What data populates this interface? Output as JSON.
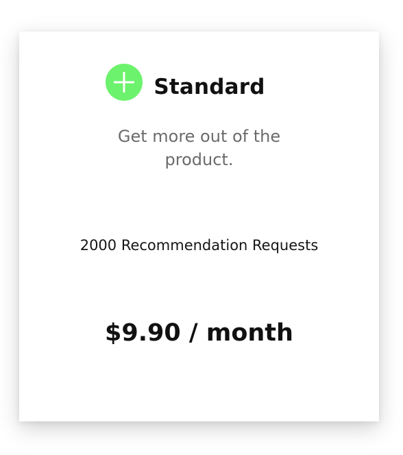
{
  "plan": {
    "name": "Standard",
    "icon": "plus-circle-icon",
    "icon_color": "#6cf26c",
    "tagline": "Get more out of the product.",
    "feature": "2000 Recommendation Requests",
    "price": "$9.90 / month"
  }
}
